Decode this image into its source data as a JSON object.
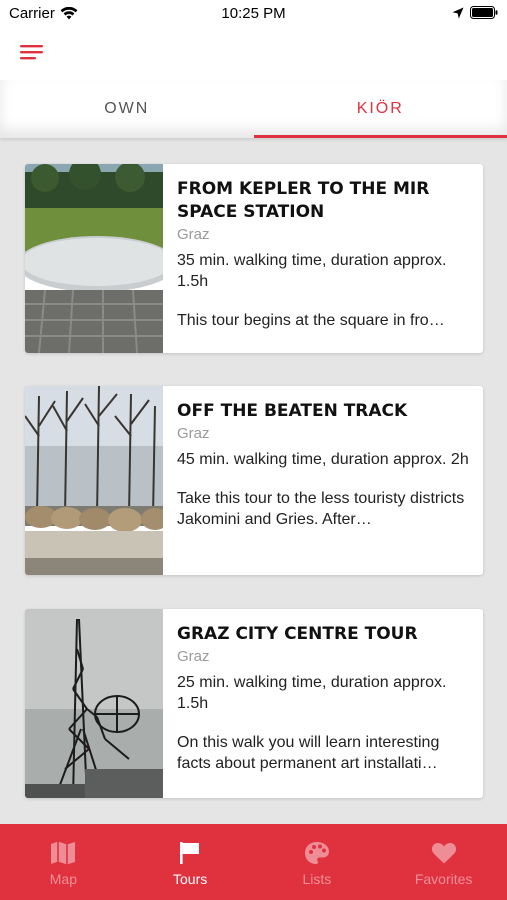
{
  "status_bar": {
    "carrier": "Carrier",
    "time": "10:25 PM"
  },
  "header": {
    "menu_icon": "hamburger-menu-icon"
  },
  "tabs": [
    {
      "label": "OWN",
      "active": false
    },
    {
      "label": "KIÖR",
      "active": true
    }
  ],
  "tours": [
    {
      "title": "FROM KEPLER TO THE MIR SPACE STATION",
      "city": "Graz",
      "duration": "35 min. walking time, duration approx. 1.5h",
      "description": "This tour begins at the square in fro…"
    },
    {
      "title": "OFF THE BEATEN TRACK",
      "city": "Graz",
      "duration": "45 min. walking time, duration approx. 2h",
      "description": "Take this tour to the less touristy districts Jakomini and Gries. After…"
    },
    {
      "title": "GRAZ CITY CENTRE TOUR",
      "city": "Graz",
      "duration": "25 min. walking time, duration approx. 1.5h",
      "description": "On this walk you will learn interesting facts about permanent art installati…"
    }
  ],
  "bottom_nav": [
    {
      "label": "Map",
      "icon": "map-icon",
      "active": false
    },
    {
      "label": "Tours",
      "icon": "flag-icon",
      "active": true
    },
    {
      "label": "Lists",
      "icon": "palette-icon",
      "active": false
    },
    {
      "label": "Favorites",
      "icon": "heart-icon",
      "active": false
    }
  ],
  "colors": {
    "accent": "#e0313f"
  }
}
